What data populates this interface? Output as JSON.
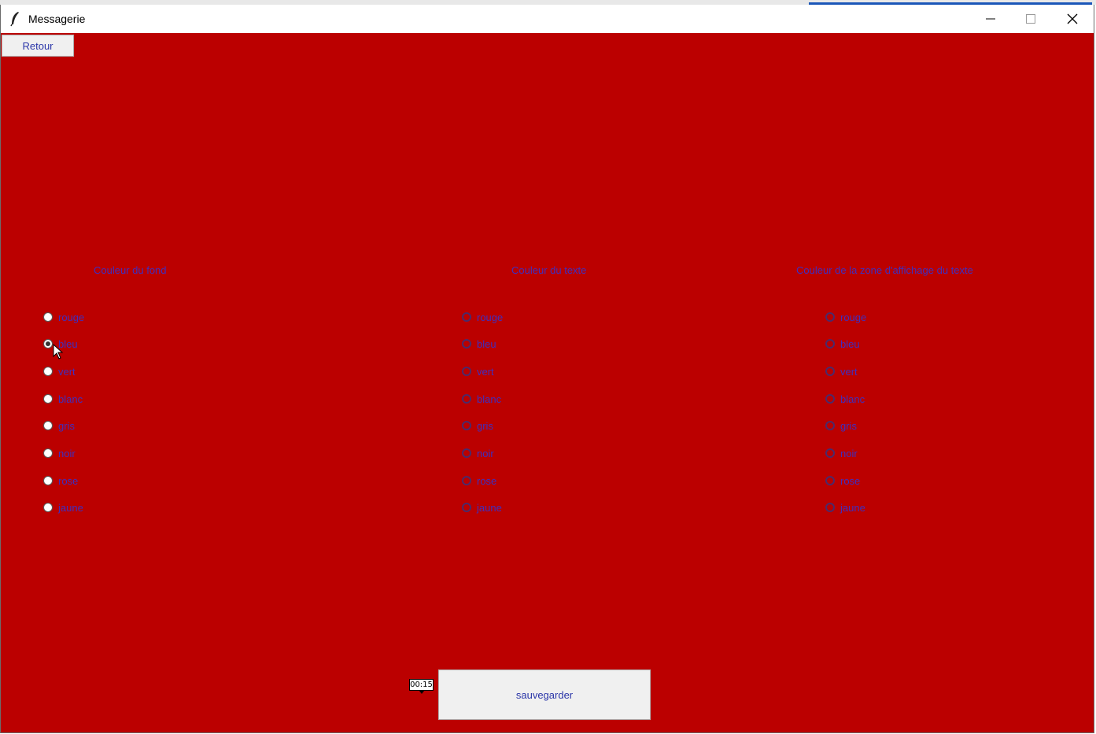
{
  "window": {
    "title": "Messagerie"
  },
  "icons": {
    "app": "feather-icon",
    "minimize": "minimize-icon",
    "maximize": "maximize-icon",
    "close": "close-icon"
  },
  "colors": {
    "background": "#bb0000",
    "label_text": "#3d2fc0",
    "button_bg": "#f0f0f0"
  },
  "toolbar": {
    "back_label": "Retour"
  },
  "sections": [
    {
      "title": "Couleur du fond",
      "options": [
        "rouge",
        "bleu",
        "vert",
        "blanc",
        "gris",
        "noir",
        "rose",
        "jaune"
      ],
      "selected": "bleu"
    },
    {
      "title": "Couleur du texte",
      "options": [
        "rouge",
        "bleu",
        "vert",
        "blanc",
        "gris",
        "noir",
        "rose",
        "jaune"
      ],
      "selected": null
    },
    {
      "title": "Couleur de la zone d'affichage du texte",
      "options": [
        "rouge",
        "bleu",
        "vert",
        "blanc",
        "gris",
        "noir",
        "rose",
        "jaune"
      ],
      "selected": null
    }
  ],
  "footer": {
    "save_label": "sauvegarder",
    "timer": "00:15"
  }
}
